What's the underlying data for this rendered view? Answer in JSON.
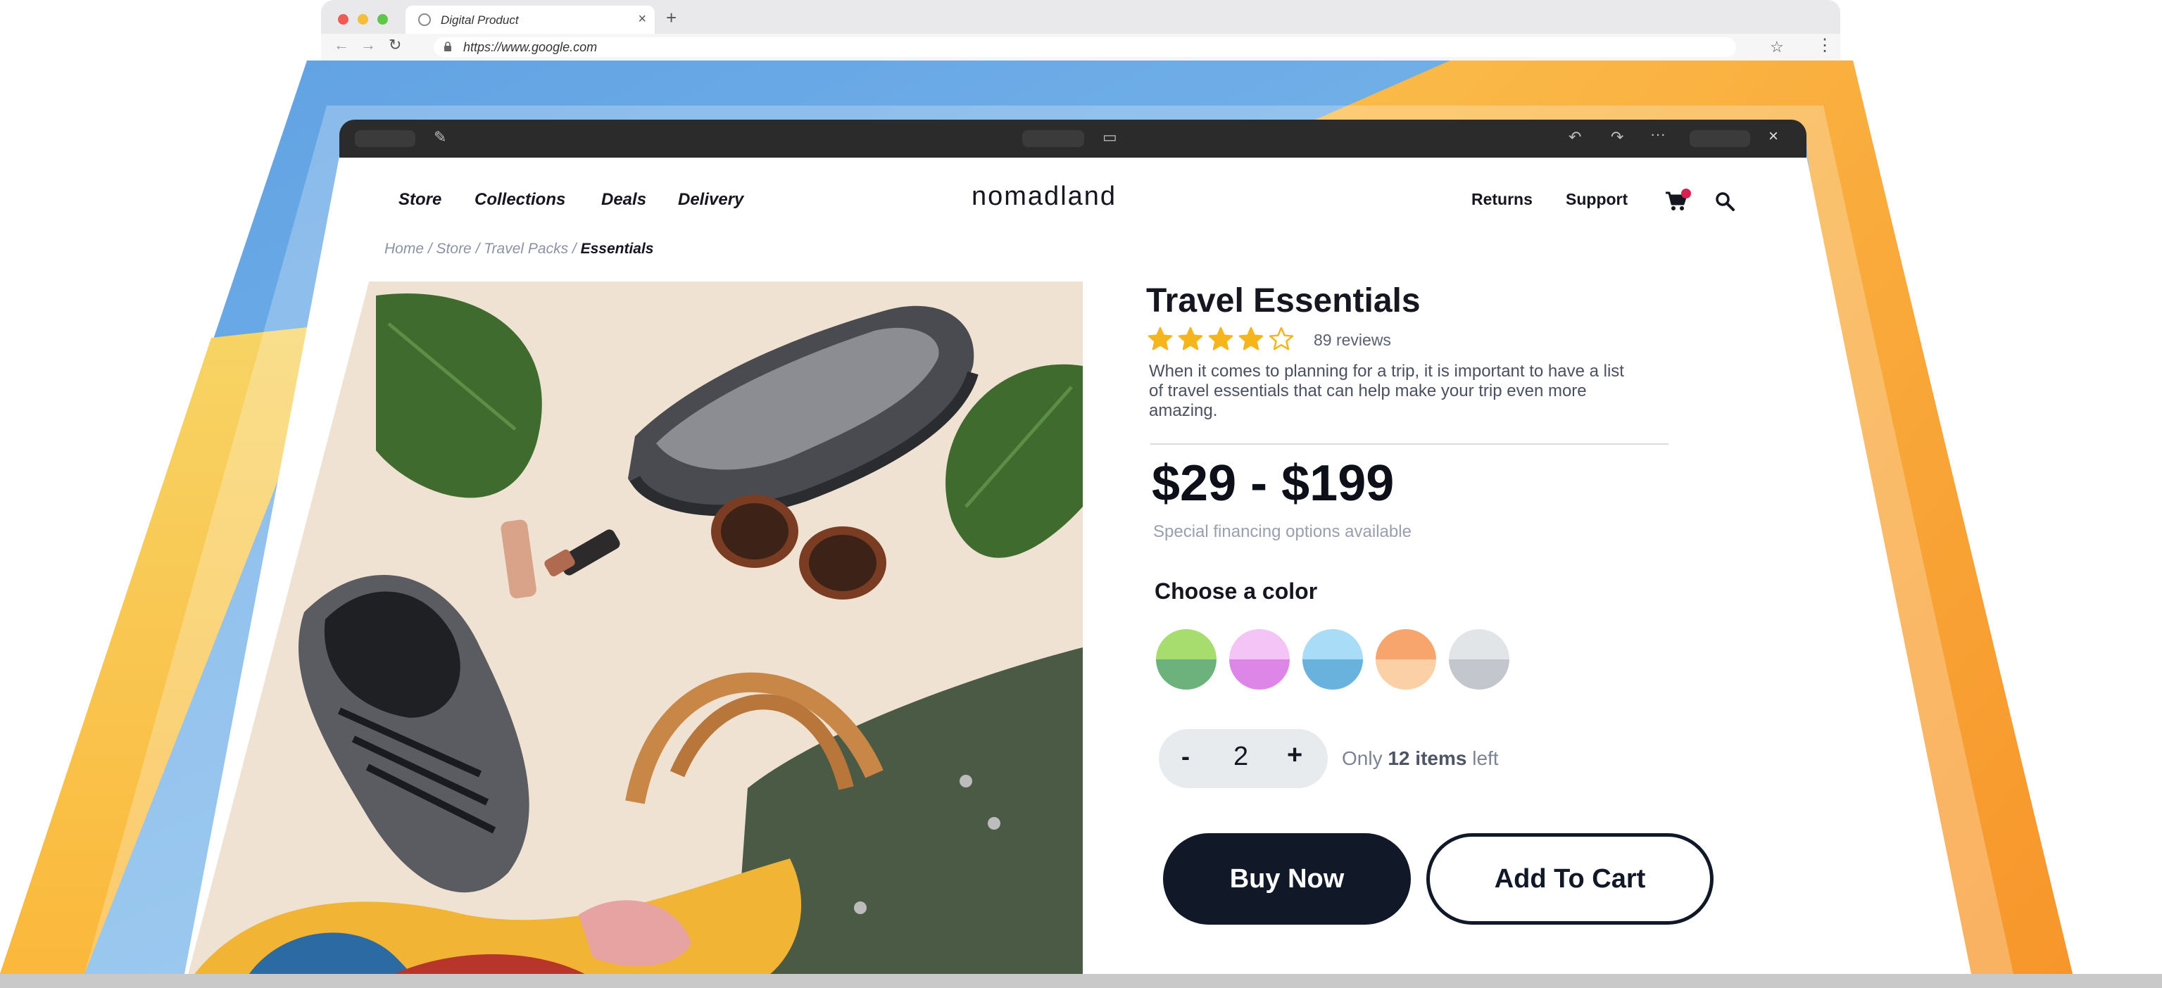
{
  "browser": {
    "tab_title": "Digital Product",
    "tab_close": "×",
    "new_tab": "+",
    "back": "←",
    "forward": "→",
    "reload": "↻",
    "url": "https://www.google.com",
    "star": "☆",
    "menu": "⋮"
  },
  "editor_bar": {
    "edit_icon": "✎",
    "monitor_icon": "▭",
    "undo_icon": "↶",
    "redo_icon": "↷",
    "more_icon": "···",
    "close_icon": "×"
  },
  "site": {
    "logo": "nomadland",
    "nav_left": [
      "Store",
      "Collections",
      "Deals",
      "Delivery"
    ],
    "nav_right": [
      "Returns",
      "Support"
    ],
    "breadcrumb": {
      "items": [
        "Home",
        "Store",
        "Travel Packs"
      ],
      "separator": " / ",
      "current": "Essentials"
    }
  },
  "product": {
    "title": "Travel Essentials",
    "rating": 4,
    "rating_max": 5,
    "reviews": "89 reviews",
    "description": "When it comes to planning for a trip, it is important to have a list of travel essentials that can help make your trip even more amazing.",
    "price": "$29 - $199",
    "financing": "Special financing options available",
    "color_heading": "Choose a color",
    "colors": [
      {
        "name": "green",
        "top": "#a6dd6e",
        "bottom": "#6db27d"
      },
      {
        "name": "pink",
        "top": "#f3c4f5",
        "bottom": "#dd86e8"
      },
      {
        "name": "blue",
        "top": "#a9dcf7",
        "bottom": "#6ab2de"
      },
      {
        "name": "orange",
        "top": "#f7a56c",
        "bottom": "#fcd0a6"
      },
      {
        "name": "gray",
        "top": "#e2e5e8",
        "bottom": "#c3c7cd"
      }
    ],
    "quantity_minus": "-",
    "quantity": "2",
    "quantity_plus": "+",
    "stock_prefix": "Only ",
    "stock_count": "12 items",
    "stock_suffix": " left",
    "buy_now": "Buy Now",
    "add_to_cart": "Add To Cart"
  },
  "colors": {
    "star": "#f6b51c",
    "cart_badge": "#d8214f",
    "button_dark": "#111827"
  }
}
